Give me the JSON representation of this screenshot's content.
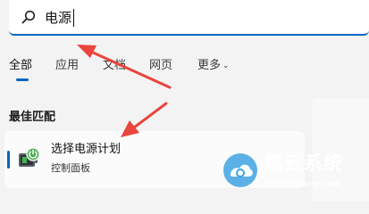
{
  "search": {
    "value": "电源"
  },
  "filters": {
    "tabs": [
      {
        "label": "全部",
        "active": true
      },
      {
        "label": "应用",
        "active": false
      },
      {
        "label": "文档",
        "active": false
      },
      {
        "label": "网页",
        "active": false
      },
      {
        "label": "更多",
        "active": false,
        "dropdown": true
      }
    ]
  },
  "best_match": {
    "heading": "最佳匹配",
    "result": {
      "title": "选择电源计划",
      "subtitle": "控制面板",
      "icon": "power-options-icon"
    }
  },
  "watermark": {
    "title": "黑云系统",
    "url": "heiyunxitong.com"
  },
  "colors": {
    "accent": "#0067c0",
    "annotation_arrow": "#e8453c",
    "watermark_logo": "#3ea3e0"
  }
}
